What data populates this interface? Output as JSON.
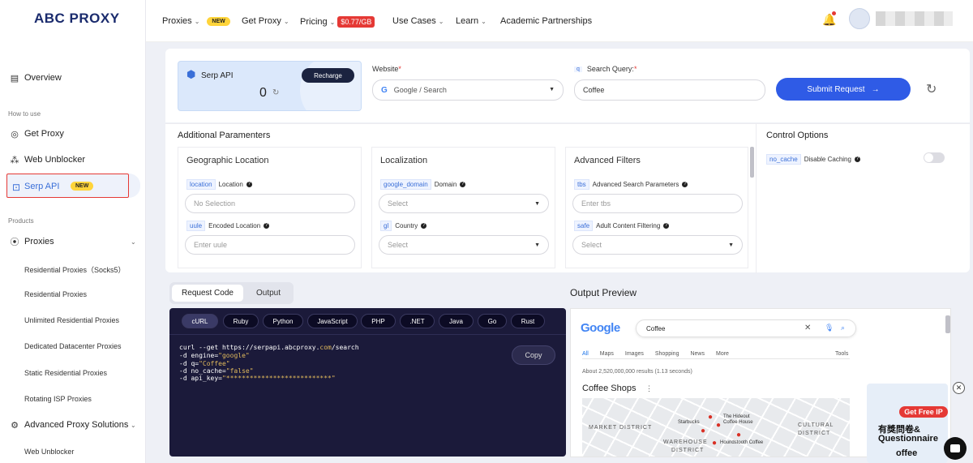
{
  "brand": {
    "logo_text": "ABC PROXY"
  },
  "sidebar": {
    "overview": "Overview",
    "section_howto": "How to use",
    "get_proxy": "Get Proxy",
    "web_unblocker": "Web Unblocker",
    "serp_api": "Serp API",
    "new_badge": "NEW",
    "section_products": "Products",
    "proxies": "Proxies",
    "proxy_items": [
      "Residential Proxies（Socks5）",
      "Residential Proxies",
      "Unlimited Residential Proxies",
      "Dedicated Datacenter Proxies",
      "Static Residential Proxies",
      "Rotating ISP Proxies"
    ],
    "advanced": "Advanced Proxy Solutions",
    "advanced_items": [
      "Web Unblocker"
    ]
  },
  "topnav": {
    "proxies": "Proxies",
    "new_badge": "NEW",
    "get_proxy": "Get Proxy",
    "pricing": "Pricing",
    "price_badge": "$0.77/GB",
    "use_cases": "Use Cases",
    "learn": "Learn",
    "academic": "Academic Partnerships"
  },
  "serp_card": {
    "title": "Serp API",
    "balance": "0",
    "recharge": "Recharge"
  },
  "website": {
    "label": "Website",
    "required": "*",
    "value": "Google / Search"
  },
  "query": {
    "label": "Search Query:",
    "required": "*",
    "value": "Coffee"
  },
  "submit": {
    "label": "Submit Request",
    "arrow": "→"
  },
  "additional": {
    "title": "Additional Paramenters"
  },
  "control": {
    "title": "Control Options",
    "chip": "no_cache",
    "label": "Disable Caching",
    "enabled": false
  },
  "geo": {
    "title": "Geographic Location",
    "f1_chip": "location",
    "f1_label": "Location",
    "f1_placeholder": "No Selection",
    "f2_chip": "uule",
    "f2_label": "Encoded Location",
    "f2_placeholder": "Enter uule"
  },
  "localization": {
    "title": "Localization",
    "f1_chip": "google_domain",
    "f1_label": "Domain",
    "f1_placeholder": "Select",
    "f2_chip": "gl",
    "f2_label": "Country",
    "f2_placeholder": "Select"
  },
  "filters": {
    "title": "Advanced Filters",
    "f1_chip": "tbs",
    "f1_label": "Advanced Search Parameters",
    "f1_placeholder": "Enter tbs",
    "f2_chip": "safe",
    "f2_label": "Adult Content Filtering",
    "f2_placeholder": "Select"
  },
  "tabs": {
    "request_code": "Request Code",
    "output": "Output"
  },
  "languages": [
    "cURL",
    "Ruby",
    "Python",
    "JavaScript",
    "PHP",
    ".NET",
    "Java",
    "Go",
    "Rust"
  ],
  "code": {
    "copy": "Copy",
    "l1a": "curl --get https://serpapi.abcproxy.",
    "l1b": "com",
    "l1c": "/search",
    "l2a": "-d engine=",
    "l2b": "\"google\"",
    "l3a": "-d q=",
    "l3b": "\"Coffee\"",
    "l4a": "-d no_cache=",
    "l4b": "\"false\"",
    "l5a": "-d api_key=",
    "l5b": "\"***************************\""
  },
  "output_preview": {
    "title": "Output Preview",
    "google_logo": "Google",
    "query": "Coffee",
    "tabs": [
      "All",
      "Maps",
      "Images",
      "Shopping",
      "News",
      "More"
    ],
    "tools": "Tools",
    "results": "About 2,520,000,000 results (1.13 seconds)",
    "section": "Coffee Shops",
    "map_labels": [
      "MARKET DISTRICT",
      "Starbucks",
      "The Hideout",
      "Coffee House",
      "CULTURAL",
      "DISTRICT",
      "WAREHOUSE",
      "DISTRICT",
      "Houndstooth Coffee"
    ]
  },
  "promo": {
    "get_free_ip": "Get Free IP",
    "line1": "有獎問卷&",
    "line2": "Questionnaire",
    "line3": "offee"
  }
}
